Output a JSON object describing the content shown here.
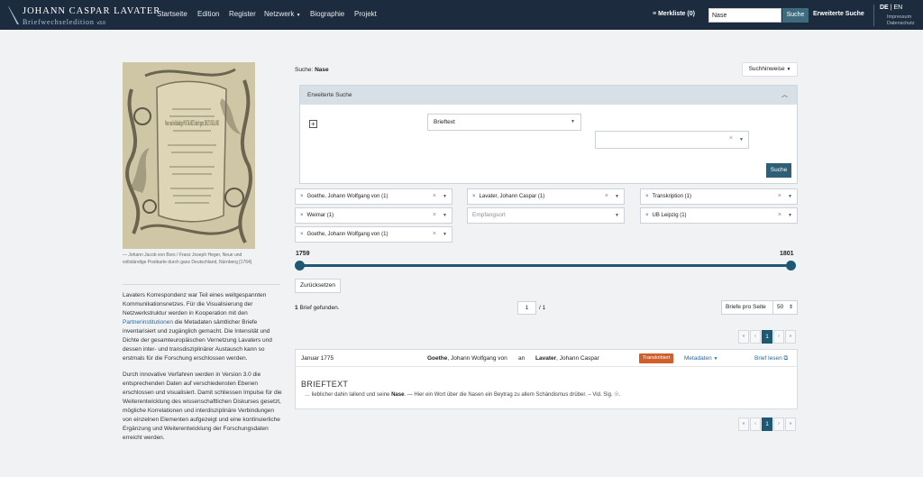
{
  "header": {
    "logo_title": "JOHANN CASPAR LAVATER",
    "logo_subtitle": "Briefwechseledition",
    "logo_version": "v3.0",
    "nav": [
      "Startseite",
      "Edition",
      "Register",
      "Netzwerk",
      "Biographie",
      "Projekt"
    ],
    "merkliste": "Merkliste (0)",
    "search_value": "Nase",
    "search_button": "Suche",
    "extended_search": "Erweiterte Suche",
    "lang_de": "DE",
    "lang_sep": "|",
    "lang_en": "EN",
    "impressum": "Impressum",
    "datenschutz": "Datenschutz"
  },
  "sidebar": {
    "caption": "— Johann Jacob von Bors / Franz Joseph Heger, Neue und vollständige Postkarte durch ganz Deutschland, Nürnberg [1764]",
    "postcard_text": "Neue und vollständige POSTKARTE durch ganz DEUTSCHLAND",
    "about_p1_start": "Lavaters Korrespondenz war Teil eines weitgespannten Kommunikationsnetzes. Für die Visualisierung der Netzwerkstruktur werden in Kooperation mit den ",
    "about_p1_link": "Partnerinstitutionen",
    "about_p1_end": " die Metadaten sämtlicher Briefe inventarisiert und zugänglich gemacht. Die Intensität und Dichte der gesamteuropäischen Vernetzung Lavaters und dessen inter- und transdisziplinärer Austausch kann so erstmals für die Forschung erschlossen werden.",
    "about_p2": "Durch innovative Verfahren werden in Version 3.0 die entsprechenden Daten auf verschiedensten Ebenen erschlossen und visualisiert. Damit schliessen Impulse für die Weiterentwicklung des wissenschaftlichen Diskurses gesetzt, mögliche Korrelationen und interdisziplinäre Verbindungen von einzelnen Elementen aufgezeigt und eine kontinuierliche Ergänzung und Weiterentwicklung der Forschungsdaten erreicht werden."
  },
  "search": {
    "label": "Suche:",
    "term": "Nase",
    "hints_button": "Suchhinweise",
    "advanced_title": "Erweiterte Suche",
    "field_select": "Brieftext",
    "advanced_button": "Suche"
  },
  "filters": {
    "f1": "Goethe, Johann Wolfgang von (1)",
    "f2": "Lavater, Johann Caspar (1)",
    "f3": "Transkription (1)",
    "f4": "Weimar (1)",
    "f5": "Empfangsort",
    "f6": "UB Leipzig (1)",
    "f7": "Goethe, Johann Wolfgang von (1)"
  },
  "range": {
    "min": "1759",
    "max": "1801",
    "min_value": 1759,
    "max_value": 1801
  },
  "reset_button": "Zurücksetzen",
  "results": {
    "found_count": "1",
    "found_text": "Brief gefunden.",
    "page": "1",
    "page_of": "/ 1",
    "per_page_label": "Briefe pro Seite",
    "per_page_value": "50",
    "pager": {
      "first": "«",
      "prev": "‹",
      "current": "1",
      "next": "›",
      "last": "»"
    }
  },
  "letter": {
    "date": "Januar 1775",
    "from_name": "Goethe",
    "from_rest": ", Johann Wolfgang von",
    "an": "an",
    "to_name": "Lavater",
    "to_rest": ", Johann Caspar",
    "badge": "Transkribiert",
    "metadata": "Metadaten",
    "read": "Brief lesen",
    "section_title": "BRIEFTEXT",
    "excerpt_pre": "… lieblicher dahin lallend und seine ",
    "excerpt_hit": "Nase",
    "excerpt_post": ". — Hier ein Wort über die Nasen ein Beytrag zu allem Schändismus drüber. – Vid. Sig. ☉."
  },
  "colors": {
    "header_bg": "#1d2b3e",
    "accent": "#1f5873",
    "badge": "#d05f2b",
    "link": "#2a6a9e"
  }
}
